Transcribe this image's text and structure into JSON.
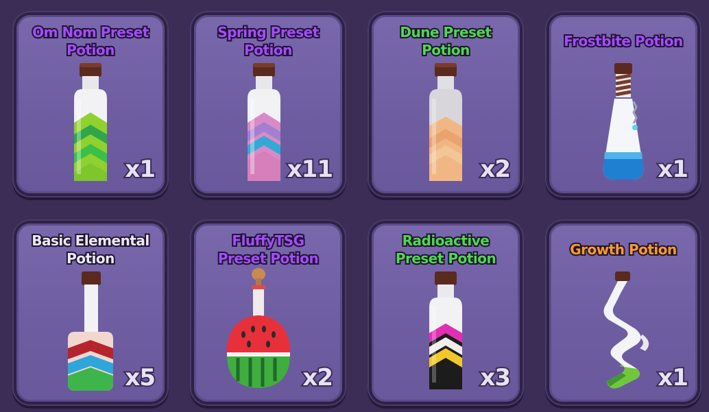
{
  "inventory": {
    "items": [
      {
        "name_line1": "Om Nom Preset",
        "name_line2": "Potion",
        "count": "x1",
        "title_color": "#a54cff",
        "icon": "om-nom-potion-icon"
      },
      {
        "name_line1": "Spring Preset",
        "name_line2": "Potion",
        "count": "x11",
        "title_color": "#a54cff",
        "icon": "spring-potion-icon"
      },
      {
        "name_line1": "Dune Preset",
        "name_line2": "Potion",
        "count": "x2",
        "title_color": "#4fd84f",
        "icon": "dune-potion-icon"
      },
      {
        "name_line1": "Frostbite Potion",
        "name_line2": "",
        "count": "x1",
        "title_color": "#a54cff",
        "icon": "frostbite-potion-icon"
      },
      {
        "name_line1": "Basic Elemental",
        "name_line2": "Potion",
        "count": "x5",
        "title_color": "#ece8f4",
        "icon": "basic-elemental-potion-icon"
      },
      {
        "name_line1": "FluffyTSG",
        "name_line2": "Preset Potion",
        "count": "x2",
        "title_color": "#a54cff",
        "icon": "watermelon-potion-icon"
      },
      {
        "name_line1": "Radioactive",
        "name_line2": "Preset Potion",
        "count": "x3",
        "title_color": "#4fd84f",
        "icon": "radioactive-potion-icon"
      },
      {
        "name_line1": "Growth Potion",
        "name_line2": "",
        "count": "x1",
        "title_color": "#ff9a2e",
        "icon": "growth-potion-icon"
      }
    ]
  }
}
